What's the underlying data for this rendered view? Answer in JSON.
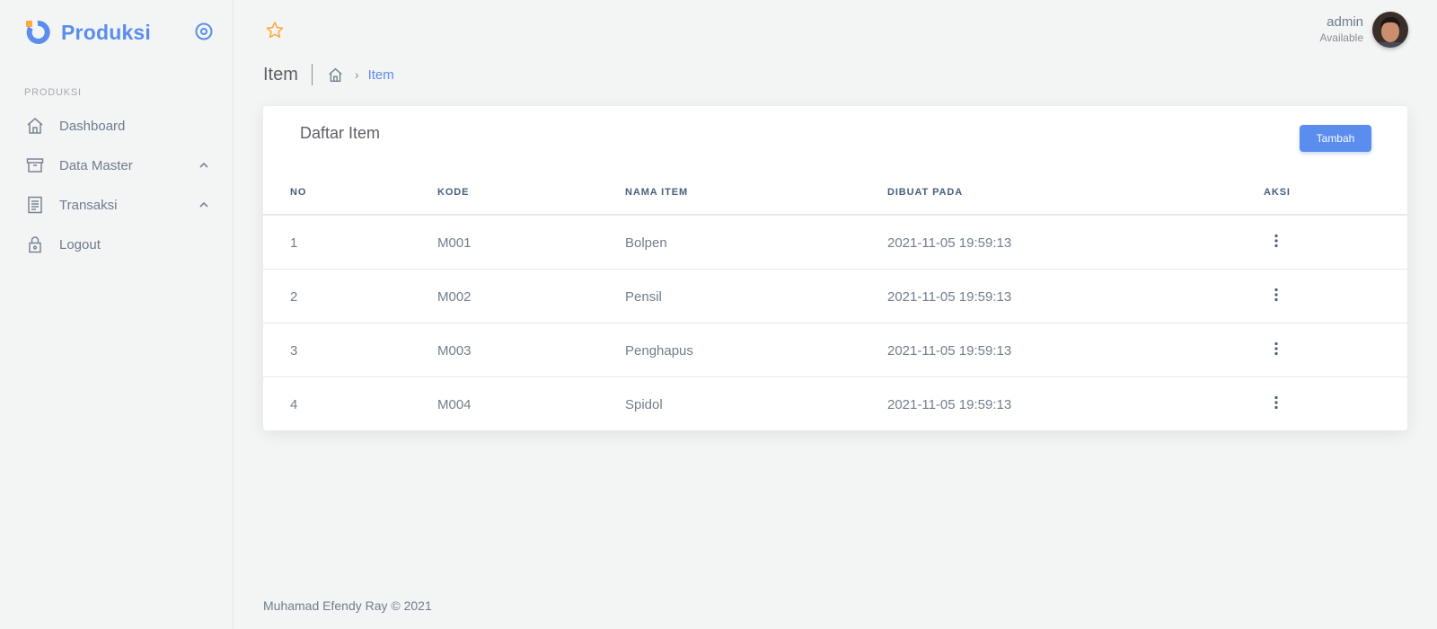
{
  "brand": {
    "name": "Produksi"
  },
  "sidebar": {
    "section": "PRODUKSI",
    "items": [
      {
        "label": "Dashboard",
        "icon": "home-icon"
      },
      {
        "label": "Data Master",
        "icon": "archive-icon",
        "expandable": true
      },
      {
        "label": "Transaksi",
        "icon": "document-icon",
        "expandable": true
      },
      {
        "label": "Logout",
        "icon": "lock-icon"
      }
    ]
  },
  "user": {
    "name": "admin",
    "status": "Available"
  },
  "breadcrumb": {
    "title": "Item",
    "active": "Item"
  },
  "card": {
    "title": "Daftar Item",
    "add_label": "Tambah",
    "columns": [
      "NO",
      "KODE",
      "NAMA ITEM",
      "DIBUAT PADA",
      "AKSI"
    ],
    "rows": [
      {
        "no": "1",
        "kode": "M001",
        "nama": "Bolpen",
        "dibuat": "2021-11-05 19:59:13"
      },
      {
        "no": "2",
        "kode": "M002",
        "nama": "Pensil",
        "dibuat": "2021-11-05 19:59:13"
      },
      {
        "no": "3",
        "kode": "M003",
        "nama": "Penghapus",
        "dibuat": "2021-11-05 19:59:13"
      },
      {
        "no": "4",
        "kode": "M004",
        "nama": "Spidol",
        "dibuat": "2021-11-05 19:59:13"
      }
    ]
  },
  "footer": {
    "text": "Muhamad Efendy Ray © 2021"
  },
  "colors": {
    "primary": "#5a8dee",
    "accent": "#fdac41",
    "background": "#f3f4f4"
  }
}
